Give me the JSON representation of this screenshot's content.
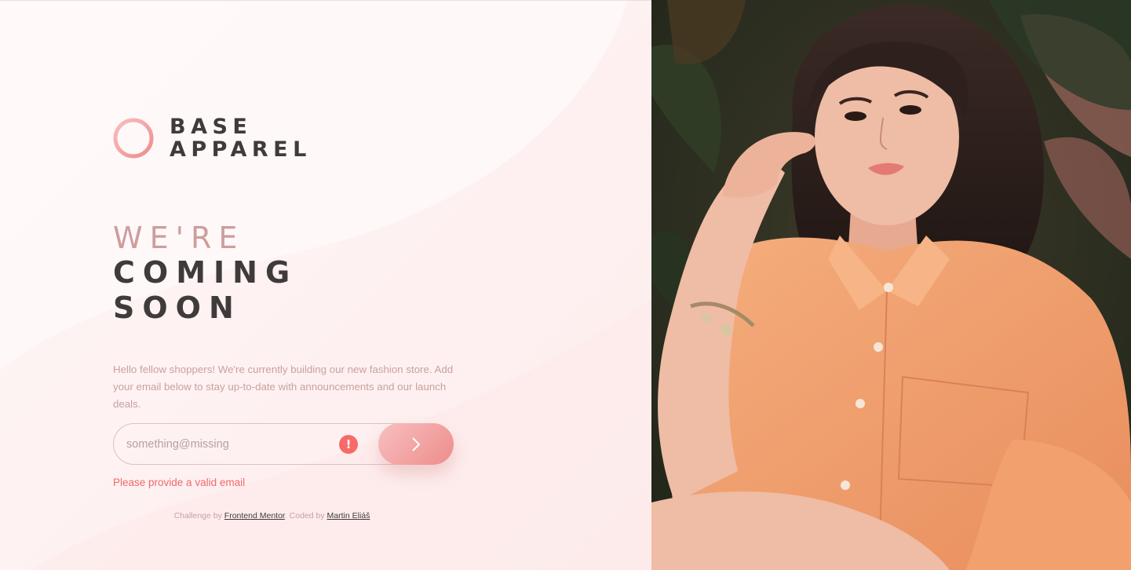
{
  "brand": {
    "line1": "BASE",
    "line2": "APPAREL"
  },
  "headline": {
    "light": "WE'RE",
    "bold1": "COMING",
    "bold2": "SOON"
  },
  "description": "Hello fellow shoppers! We're currently building our new fashion store. Add your email below to stay up-to-date with announcements and our launch deals.",
  "form": {
    "email_value": "something@missing",
    "error_message": "Please provide a valid email",
    "error_icon": "exclamation-icon",
    "submit_icon": "chevron-right-icon"
  },
  "attribution": {
    "prefix": "Challenge by ",
    "link1": "Frontend Mentor",
    "middle": ". Coded by ",
    "link2": "Martin Eliáš"
  },
  "colors": {
    "accent": "#f66a6a",
    "dark_text": "#3f3b3b",
    "muted_pink": "#cd9d9d",
    "shirt": "#f2a06e"
  }
}
